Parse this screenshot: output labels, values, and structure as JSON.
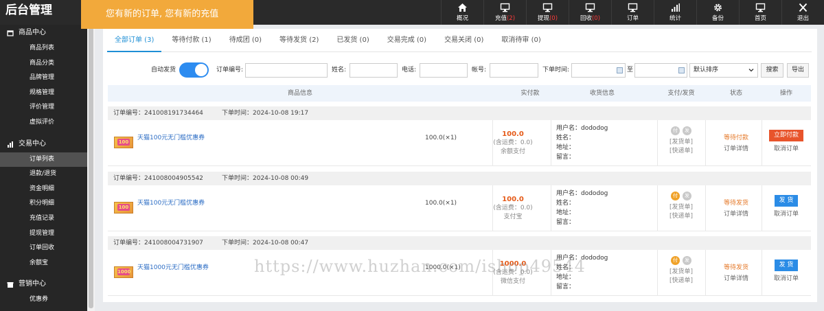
{
  "brand": "后台管理",
  "notice": "您有新的订单, 您有新的充值",
  "nav": [
    {
      "icon": "home-icon",
      "label": "概况",
      "count": ""
    },
    {
      "icon": "monitor-icon",
      "label": "充值",
      "count": "(2)"
    },
    {
      "icon": "monitor-icon",
      "label": "提现",
      "count": "(0)"
    },
    {
      "icon": "monitor-icon",
      "label": "回收",
      "count": "(0)"
    },
    {
      "icon": "monitor-icon",
      "label": "订单",
      "count": ""
    },
    {
      "icon": "bar-chart-icon",
      "label": "统计",
      "count": ""
    },
    {
      "icon": "gear-icon",
      "label": "备份",
      "count": ""
    },
    {
      "icon": "monitor-icon",
      "label": "首页",
      "count": ""
    },
    {
      "icon": "close-icon",
      "label": "退出",
      "count": ""
    }
  ],
  "sidebar": {
    "groups": [
      {
        "label": "商品中心",
        "items": [
          "商品列表",
          "商品分类",
          "品牌管理",
          "规格管理",
          "评价管理",
          "虚拟评价"
        ]
      },
      {
        "label": "交易中心",
        "items": [
          "订单列表",
          "退款/退货",
          "资金明细",
          "积分明细",
          "充值记录",
          "提现管理",
          "订单回收",
          "余额宝"
        ]
      },
      {
        "label": "营销中心",
        "items": [
          "优惠券"
        ]
      }
    ],
    "active": "订单列表"
  },
  "tabs": [
    {
      "label": "全部订单 (3)",
      "active": true
    },
    {
      "label": "等待付款 (1)",
      "active": false
    },
    {
      "label": "待成团 (0)",
      "active": false
    },
    {
      "label": "等待发货 (2)",
      "active": false
    },
    {
      "label": "已发货 (0)",
      "active": false
    },
    {
      "label": "交易完成 (0)",
      "active": false
    },
    {
      "label": "交易关闭 (0)",
      "active": false
    },
    {
      "label": "取消待审 (0)",
      "active": false
    }
  ],
  "filters": {
    "auto_ship_label": "自动发货",
    "auto_ship_on": true,
    "order_no_label": "订单编号:",
    "name_label": "姓名:",
    "phone_label": "电话:",
    "account_label": "帐号:",
    "time_label": "下单时间:",
    "to_label": "至",
    "sort_value": "默认排序",
    "search_btn": "搜索",
    "export_btn": "导出"
  },
  "table_headers": [
    "商品信息",
    "实付款",
    "收货信息",
    "支付/发货",
    "状态",
    "操作"
  ],
  "orders": [
    {
      "order_no_label": "订单编号：241008191734464",
      "time_label": "下单时间：2024-10-08 19:17",
      "product": "天猫100元无门槛优惠券",
      "thumb_text": "100",
      "price_qty": "100.0(×1)",
      "paid": "100.0",
      "freight": "(含运费：0.0)",
      "pay_method": "余额支付",
      "user": "用户名：dododog",
      "name": "姓名：",
      "address": "地址：",
      "message": "留言：",
      "pay_dot": "付",
      "ship_dot": "发",
      "pay_on": false,
      "ship_link": "[发货单]",
      "express_link": "[快递单]",
      "status": "等待付款",
      "detail": "订单详情",
      "action": "立即付款",
      "action_color": "red",
      "cancel": "取消订单"
    },
    {
      "order_no_label": "订单编号：241008004905542",
      "time_label": "下单时间：2024-10-08 00:49",
      "product": "天猫100元无门槛优惠券",
      "thumb_text": "100",
      "price_qty": "100.0(×1)",
      "paid": "100.0",
      "freight": "(含运费：0.0)",
      "pay_method": "支付宝",
      "user": "用户名：dododog",
      "name": "姓名：",
      "address": "地址：",
      "message": "留言：",
      "pay_dot": "付",
      "ship_dot": "发",
      "pay_on": true,
      "ship_link": "[发货单]",
      "express_link": "[快递单]",
      "status": "等待发货",
      "detail": "订单详情",
      "action": "发 货",
      "action_color": "blue",
      "cancel": "取消订单"
    },
    {
      "order_no_label": "订单编号：241008004731907",
      "time_label": "下单时间：2024-10-08 00:47",
      "product": "天猫1000元无门槛优惠券",
      "thumb_text": "1000",
      "price_qty": "1000.0(×1)",
      "paid": "1000.0",
      "freight": "(含运费：0.0)",
      "pay_method": "微信支付",
      "user": "用户名：dododog",
      "name": "姓名：",
      "address": "地址：",
      "message": "留言：",
      "pay_dot": "付",
      "ship_dot": "发",
      "pay_on": true,
      "ship_link": "[发货单]",
      "express_link": "[快递单]",
      "status": "等待发货",
      "detail": "订单详情",
      "action": "发 货",
      "action_color": "blue",
      "cancel": "取消订单"
    }
  ],
  "watermark": "https://www.huzhan.com/ishop49544",
  "colors": {
    "accent": "#1e8fd5",
    "notice": "#f2a93b",
    "topbar": "#2a2a2a",
    "sidebar": "#262626",
    "price": "#e55a18"
  }
}
